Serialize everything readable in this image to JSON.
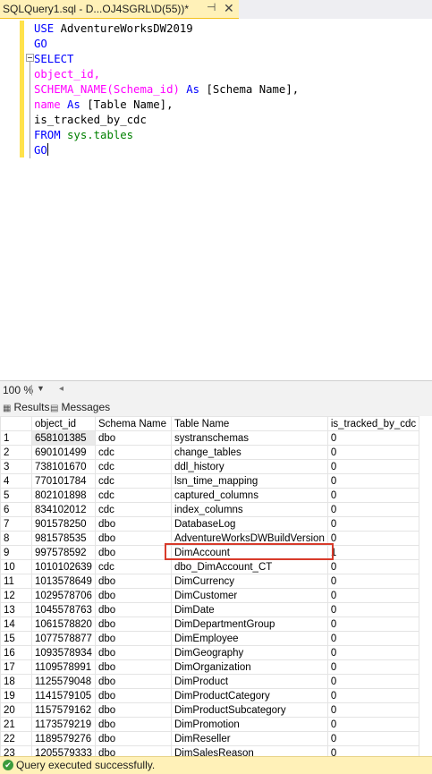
{
  "tab": {
    "title": "SQLQuery1.sql - D...OJ4SGRL\\D(55))*",
    "pin_icon": "pin-icon",
    "close_icon": "close-icon"
  },
  "code": {
    "line1_kw": "USE",
    "line1_db": " AdventureWorksDW2019",
    "go1": "GO",
    "select": "SELECT",
    "l4": "object_id,",
    "l5_fn": "SCHEMA_NAME(Schema_id)",
    "l5_as": " As",
    "l5_alias": " [Schema Name],",
    "l6_col": "name",
    "l6_as": " As",
    "l6_alias": " [Table Name],",
    "l7": "is_tracked_by_cdc",
    "l8_from": "FROM",
    "l8_tbl": " sys.tables",
    "go2": "GO"
  },
  "zoom": {
    "value": "100 %"
  },
  "results_tabs": {
    "results": "Results",
    "messages": "Messages"
  },
  "grid": {
    "headers": [
      "object_id",
      "Schema Name",
      "Table Name",
      "is_tracked_by_cdc"
    ],
    "rows": [
      [
        "1",
        "658101385",
        "dbo",
        "systranschemas",
        "0"
      ],
      [
        "2",
        "690101499",
        "cdc",
        "change_tables",
        "0"
      ],
      [
        "3",
        "738101670",
        "cdc",
        "ddl_history",
        "0"
      ],
      [
        "4",
        "770101784",
        "cdc",
        "lsn_time_mapping",
        "0"
      ],
      [
        "5",
        "802101898",
        "cdc",
        "captured_columns",
        "0"
      ],
      [
        "6",
        "834102012",
        "cdc",
        "index_columns",
        "0"
      ],
      [
        "7",
        "901578250",
        "dbo",
        "DatabaseLog",
        "0"
      ],
      [
        "8",
        "981578535",
        "dbo",
        "AdventureWorksDWBuildVersion",
        "0"
      ],
      [
        "9",
        "997578592",
        "dbo",
        "DimAccount",
        "1"
      ],
      [
        "10",
        "1010102639",
        "cdc",
        "dbo_DimAccount_CT",
        "0"
      ],
      [
        "11",
        "1013578649",
        "dbo",
        "DimCurrency",
        "0"
      ],
      [
        "12",
        "1029578706",
        "dbo",
        "DimCustomer",
        "0"
      ],
      [
        "13",
        "1045578763",
        "dbo",
        "DimDate",
        "0"
      ],
      [
        "14",
        "1061578820",
        "dbo",
        "DimDepartmentGroup",
        "0"
      ],
      [
        "15",
        "1077578877",
        "dbo",
        "DimEmployee",
        "0"
      ],
      [
        "16",
        "1093578934",
        "dbo",
        "DimGeography",
        "0"
      ],
      [
        "17",
        "1109578991",
        "dbo",
        "DimOrganization",
        "0"
      ],
      [
        "18",
        "1125579048",
        "dbo",
        "DimProduct",
        "0"
      ],
      [
        "19",
        "1141579105",
        "dbo",
        "DimProductCategory",
        "0"
      ],
      [
        "20",
        "1157579162",
        "dbo",
        "DimProductSubcategory",
        "0"
      ],
      [
        "21",
        "1173579219",
        "dbo",
        "DimPromotion",
        "0"
      ],
      [
        "22",
        "1189579276",
        "dbo",
        "DimReseller",
        "0"
      ],
      [
        "23",
        "1205579333",
        "dbo",
        "DimSalesReason",
        "0"
      ]
    ]
  },
  "status": {
    "message": "Query executed successfully."
  },
  "colors": {
    "highlight_box": "#d83b2b",
    "status_bar": "#fff1b8",
    "tab_active": "#fff1b8"
  }
}
